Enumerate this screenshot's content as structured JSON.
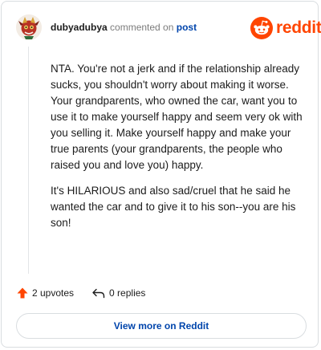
{
  "comment": {
    "author": "dubyadubya",
    "action": "commented on",
    "target": "post",
    "paragraphs": [
      "NTA. You're not a jerk and if the relationship already sucks, you shouldn't worry about making it worse. Your grandparents, who owned the car, want you to use it to make yourself happy and seem very ok with you selling it. Make yourself happy and make your true parents (your grandparents, the people who raised you and love you) happy.",
      "It's HILARIOUS and also sad/cruel that he said he wanted the car and to give it to his son--you are his son!"
    ]
  },
  "brand": {
    "name": "reddit",
    "icon": "reddit-snoo-icon",
    "color": "#ff4500"
  },
  "stats": {
    "upvotes_label": "2 upvotes",
    "replies_label": "0 replies",
    "upvote_icon": "upvote-arrow-icon",
    "reply_icon": "reply-arrow-icon"
  },
  "cta": {
    "label": "View more on Reddit"
  },
  "colors": {
    "accent": "#ff4500",
    "link": "#0045ac",
    "text": "#1c1c1c",
    "muted": "#7c7c7c",
    "border": "#d9dde0"
  }
}
